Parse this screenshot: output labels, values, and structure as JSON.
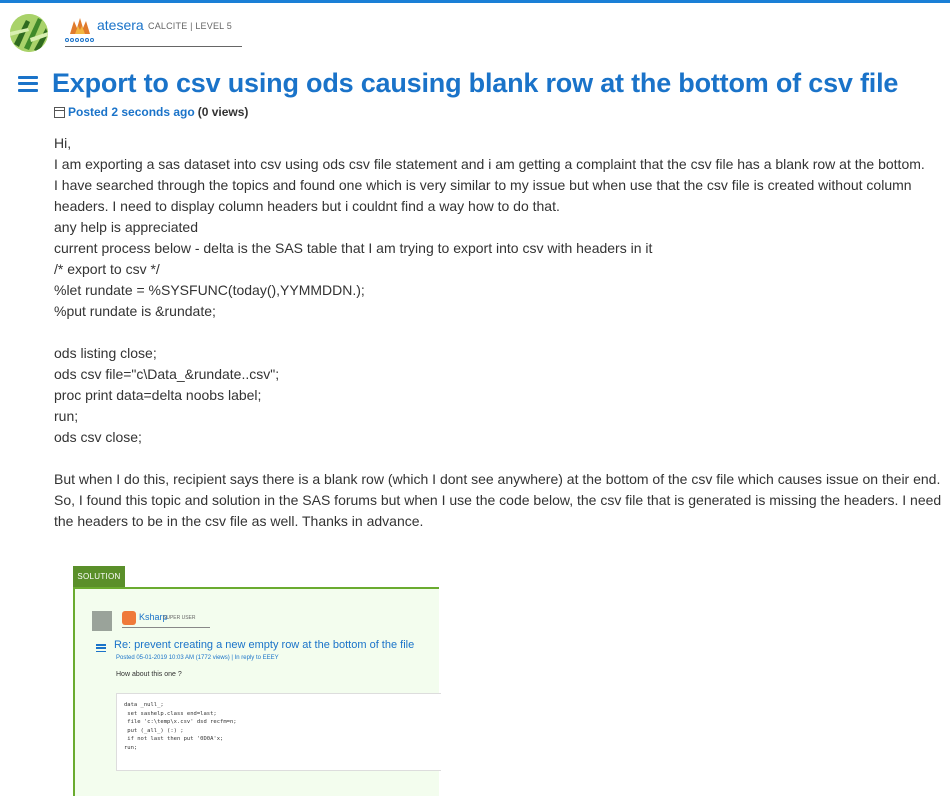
{
  "author": {
    "username": "atesera",
    "rank": "CALCITE | LEVEL 5"
  },
  "post": {
    "title": "Export to csv using ods causing blank row at the bottom of csv file",
    "posted_label": "Posted 2 seconds ago",
    "views": "(0 views)",
    "body": [
      "Hi,",
      "I am exporting a sas dataset into csv using ods csv file statement and i am getting a complaint that the csv file has a blank row at the bottom.",
      "I have searched through the topics and found one which is very similar to my issue but when use that the csv file is created without column headers. I need to display column headers but i couldnt find a way how to do that.",
      "any help is appreciated",
      "current process below - delta is the SAS table that I am trying to export into csv with headers in it",
      "/* export to csv */",
      "%let rundate = %SYSFUNC(today(),YYMMDDN.);",
      "%put rundate is &rundate;",
      "",
      "ods listing close;",
      "ods csv file=\"c\\Data_&rundate..csv\";",
      "proc print data=delta noobs label;",
      "run;",
      "ods csv close;",
      "",
      "But when I do this, recipient says there is a blank row (which I dont see anywhere) at the bottom of the csv file which causes issue on their end.",
      "So, I found this topic and solution in the SAS forums but when I use the code below, the csv file that is generated is missing the headers. I need the headers to be in the csv file as well. Thanks in advance."
    ]
  },
  "embedded": {
    "tab": "SOLUTION",
    "username": "Ksharp",
    "rank": "SUPER USER",
    "title": "Re: prevent creating a new empty row at the bottom of the file",
    "meta": "Posted 05-01-2019 10:03 AM (1772 views) | In reply to EEEY",
    "text": "How about this one ?",
    "code": [
      "data _null_;",
      " set sashelp.class end=last;",
      " file 'c:\\temp\\x.csv' dsd recfm=n;",
      " put (_all_) (:) ;",
      " if not last then put '0D0A'x;",
      "run;"
    ]
  }
}
